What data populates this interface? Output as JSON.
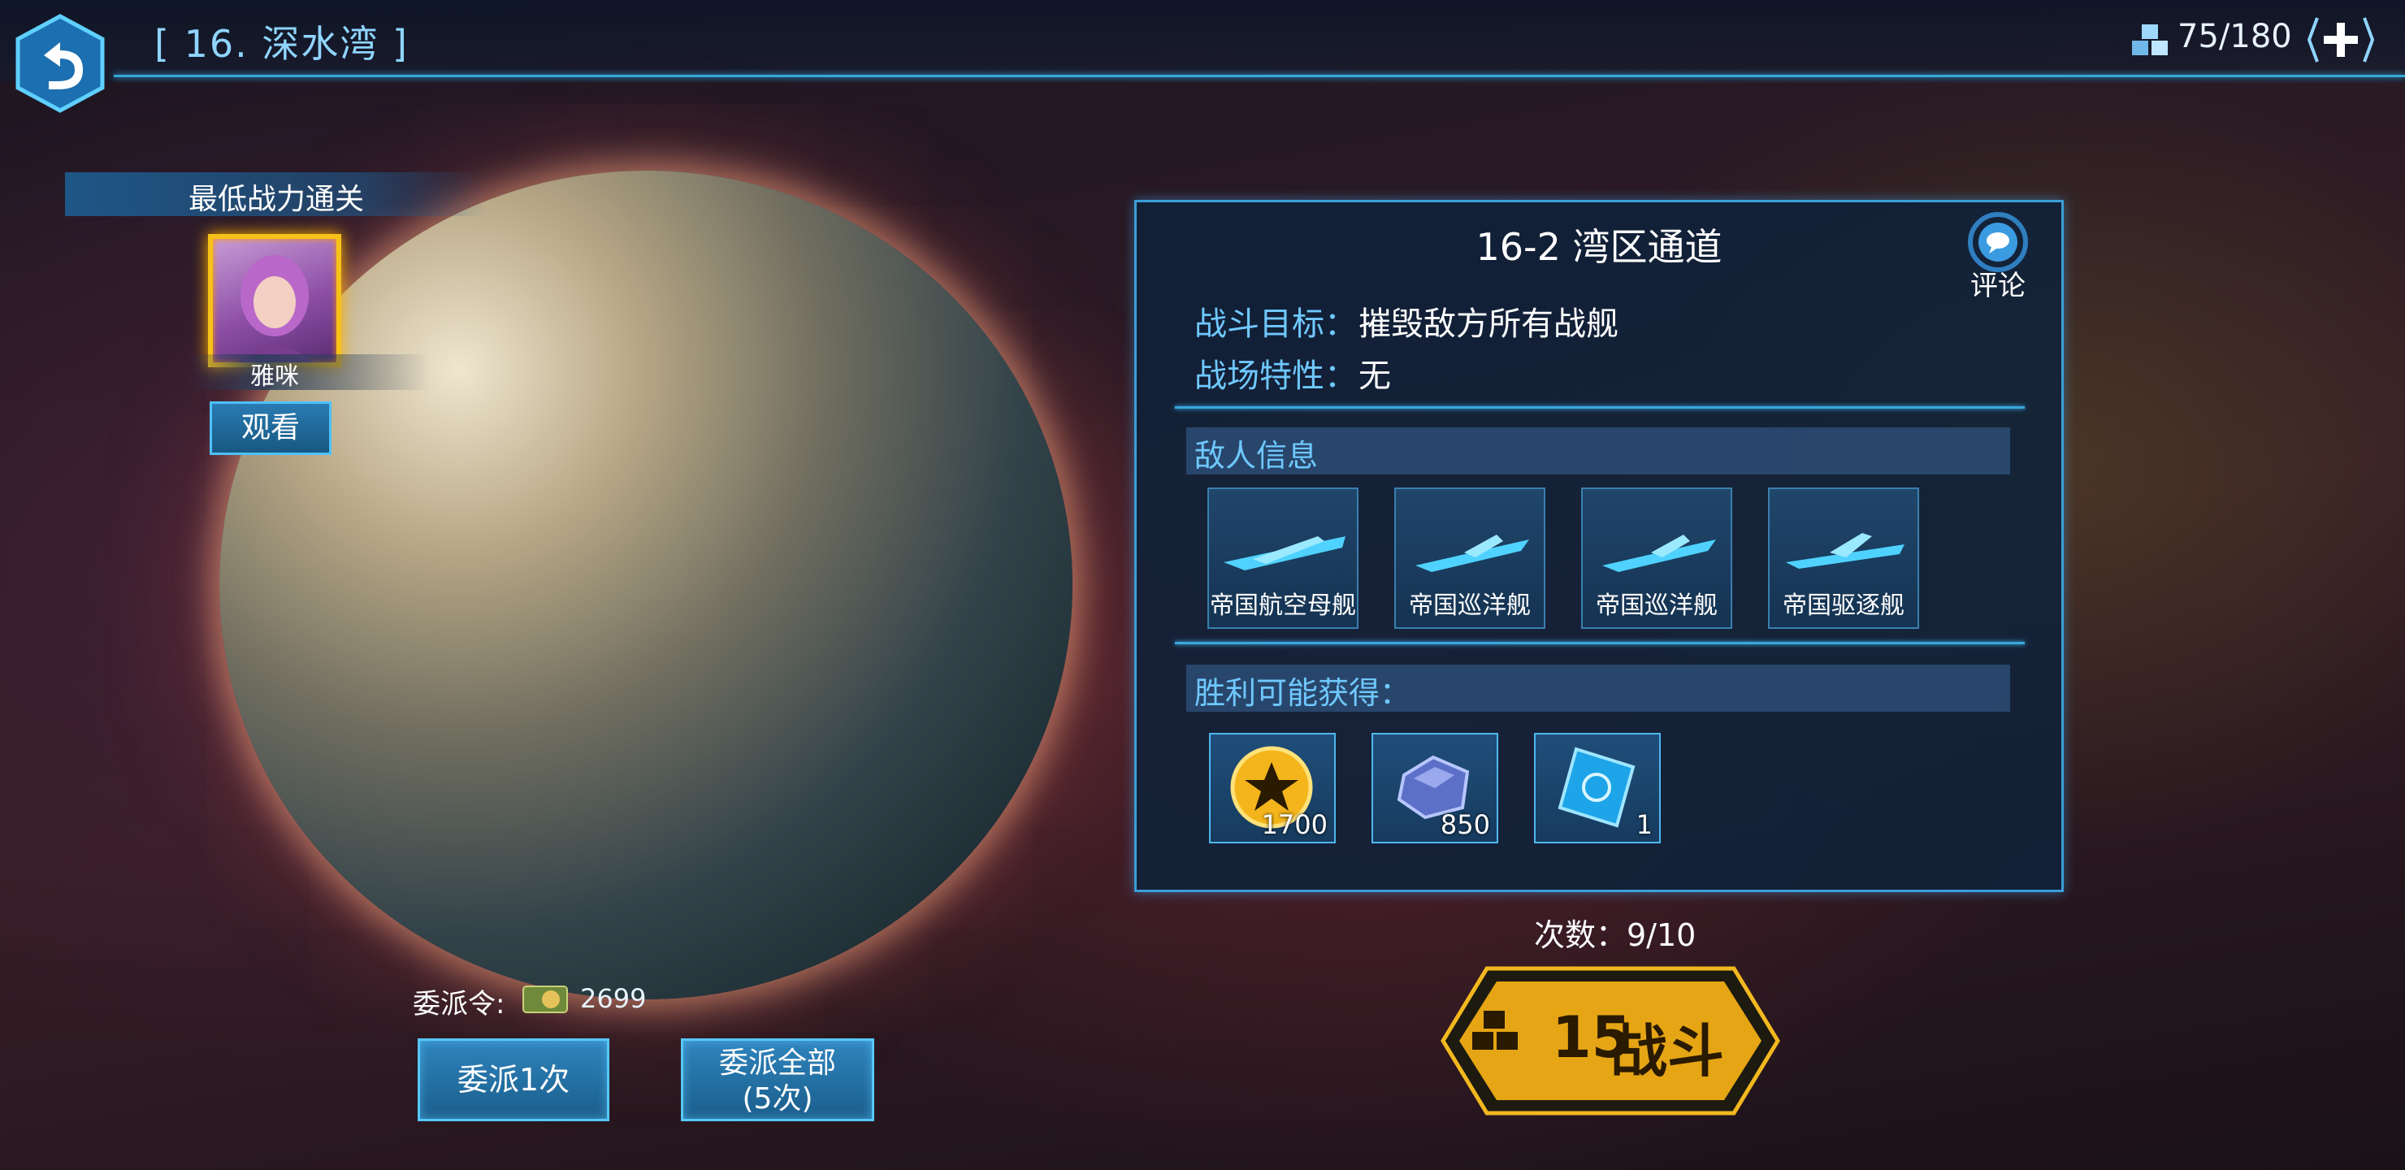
{
  "header": {
    "stage_title": "[ 16. 深水湾 ]",
    "energy": "75/180"
  },
  "min_power": {
    "title": "最低战力通关",
    "player_name": "雅咪",
    "watch_label": "观看"
  },
  "dispatch": {
    "label": "委派令:",
    "token_count": "2699",
    "once_label": "委派1次",
    "all_label_line1": "委派全部",
    "all_label_line2": "(5次)"
  },
  "panel": {
    "stage_name": "16-2 湾区通道",
    "comment_label": "评论",
    "objective_label": "战斗目标：",
    "objective_value": "摧毁敌方所有战舰",
    "feature_label": "战场特性：",
    "feature_value": "无",
    "enemy_section": "敌人信息",
    "enemies": [
      {
        "name": "帝国航空母舰",
        "icon": "carrier-ship-icon"
      },
      {
        "name": "帝国巡洋舰",
        "icon": "cruiser-ship-icon"
      },
      {
        "name": "帝国巡洋舰",
        "icon": "cruiser-ship-icon"
      },
      {
        "name": "帝国驱逐舰",
        "icon": "destroyer-ship-icon"
      }
    ],
    "reward_section": "胜利可能获得：",
    "rewards": [
      {
        "icon": "gold-coin-icon",
        "count": "1700"
      },
      {
        "icon": "crystal-ore-icon",
        "count": "850"
      },
      {
        "icon": "blueprint-chip-icon",
        "count": "1"
      }
    ]
  },
  "battle": {
    "attempts": "次数：9/10",
    "cost": "15",
    "label": "战斗"
  },
  "colors": {
    "accent_blue": "#3b9ed8",
    "label_blue": "#6fc8ff",
    "battle_gold": "#f2b81e"
  }
}
